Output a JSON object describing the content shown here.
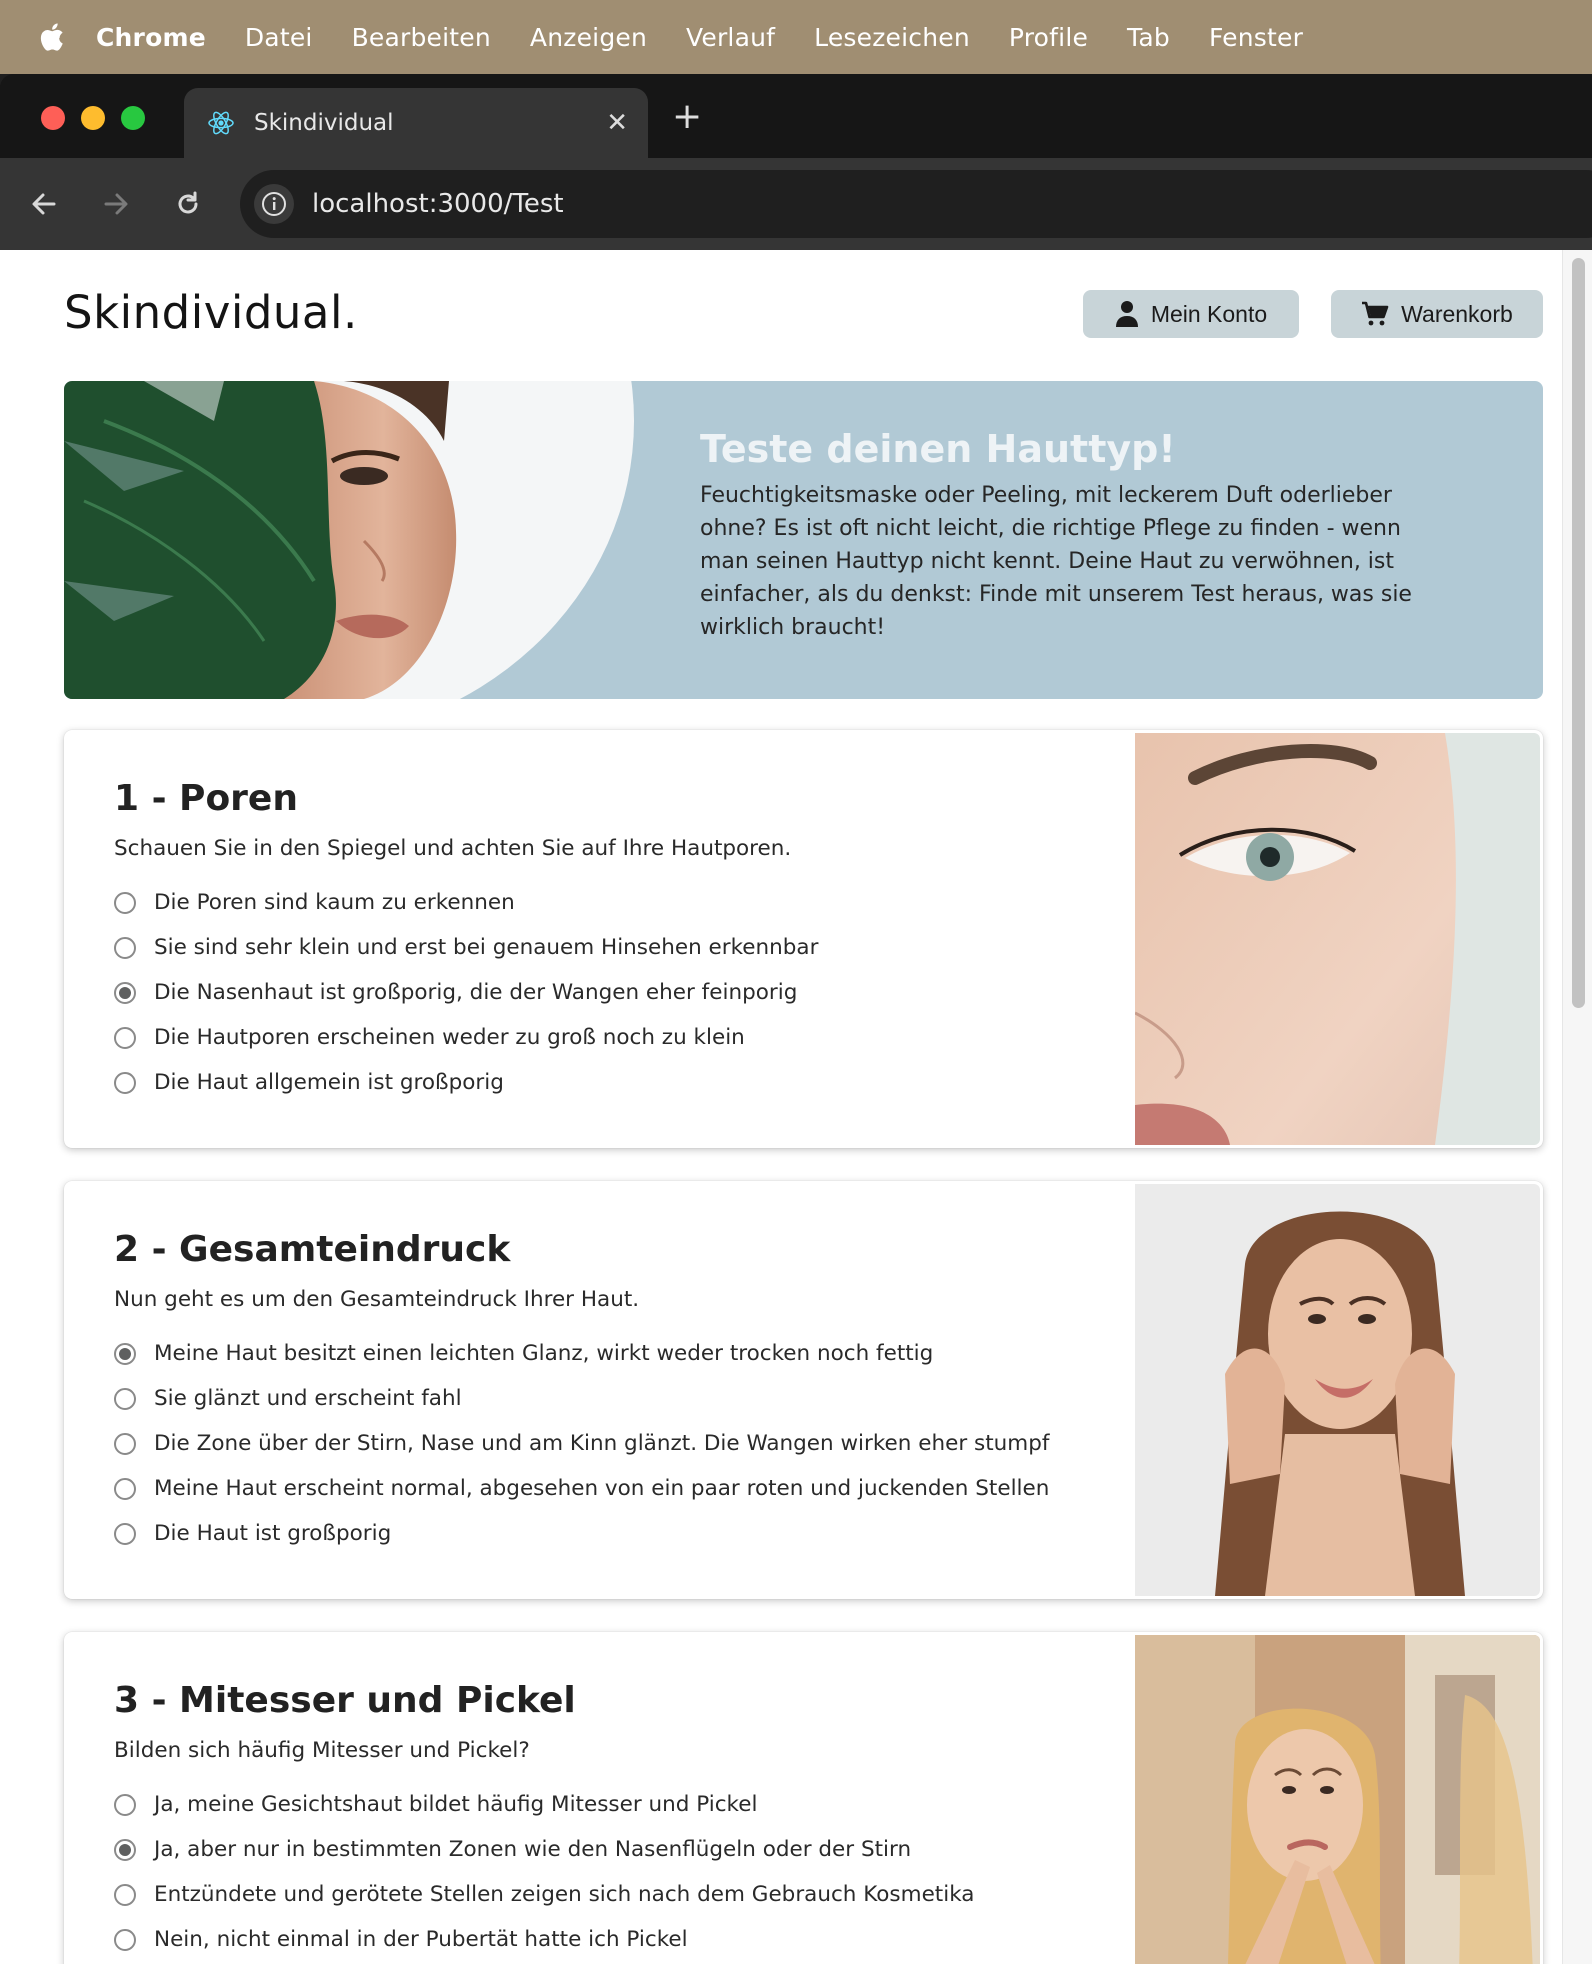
{
  "menubar": {
    "app": "Chrome",
    "items": [
      "Datei",
      "Bearbeiten",
      "Anzeigen",
      "Verlauf",
      "Lesezeichen",
      "Profile",
      "Tab",
      "Fenster"
    ]
  },
  "browser": {
    "tab_title": "Skindividual",
    "url": "localhost:3000/Test"
  },
  "header": {
    "logo": "Skindividual.",
    "account_label": "Mein Konto",
    "cart_label": "Warenkorb"
  },
  "hero": {
    "title": "Teste deinen Hauttyp!",
    "text": "Feuchtigkeitsmaske oder Peeling, mit leckerem Duft oderlieber ohne? Es ist oft nicht leicht, die richtige Pflege zu finden - wenn man seinen Hauttyp nicht kennt. Deine Haut zu verwöhnen, ist einfacher, als du denkst: Finde mit unserem Test heraus, was sie wirklich braucht!"
  },
  "questions": [
    {
      "title": "1 - Poren",
      "prompt": "Schauen Sie in den Spiegel und achten Sie auf Ihre Hautporen.",
      "options": [
        "Die Poren sind kaum zu erkennen",
        "Sie sind sehr klein und erst bei genauem Hinsehen erkennbar",
        "Die Nasenhaut ist großporig, die der Wangen eher feinporig",
        "Die Hautporen erscheinen weder zu groß noch zu klein",
        "Die Haut allgemein ist großporig"
      ],
      "selected": 2
    },
    {
      "title": "2 - Gesamteindruck",
      "prompt": "Nun geht es um den Gesamteindruck Ihrer Haut.",
      "options": [
        "Meine Haut besitzt einen leichten Glanz, wirkt weder trocken noch fettig",
        "Sie glänzt und erscheint fahl",
        "Die Zone über der Stirn, Nase und am Kinn glänzt. Die Wangen wirken eher stumpf",
        "Meine Haut erscheint normal, abgesehen von ein paar roten und juckenden Stellen",
        "Die Haut ist großporig"
      ],
      "selected": 0
    },
    {
      "title": "3 - Mitesser und Pickel",
      "prompt": "Bilden sich häufig Mitesser und Pickel?",
      "options": [
        "Ja, meine Gesichtshaut bildet häufig Mitesser und Pickel",
        "Ja, aber nur in bestimmten Zonen wie den Nasenflügeln oder der Stirn",
        "Entzündete und gerötete Stellen zeigen sich nach dem Gebrauch Kosmetika",
        "Nein, nicht einmal in der Pubertät hatte ich Pickel"
      ],
      "selected": 1
    }
  ]
}
